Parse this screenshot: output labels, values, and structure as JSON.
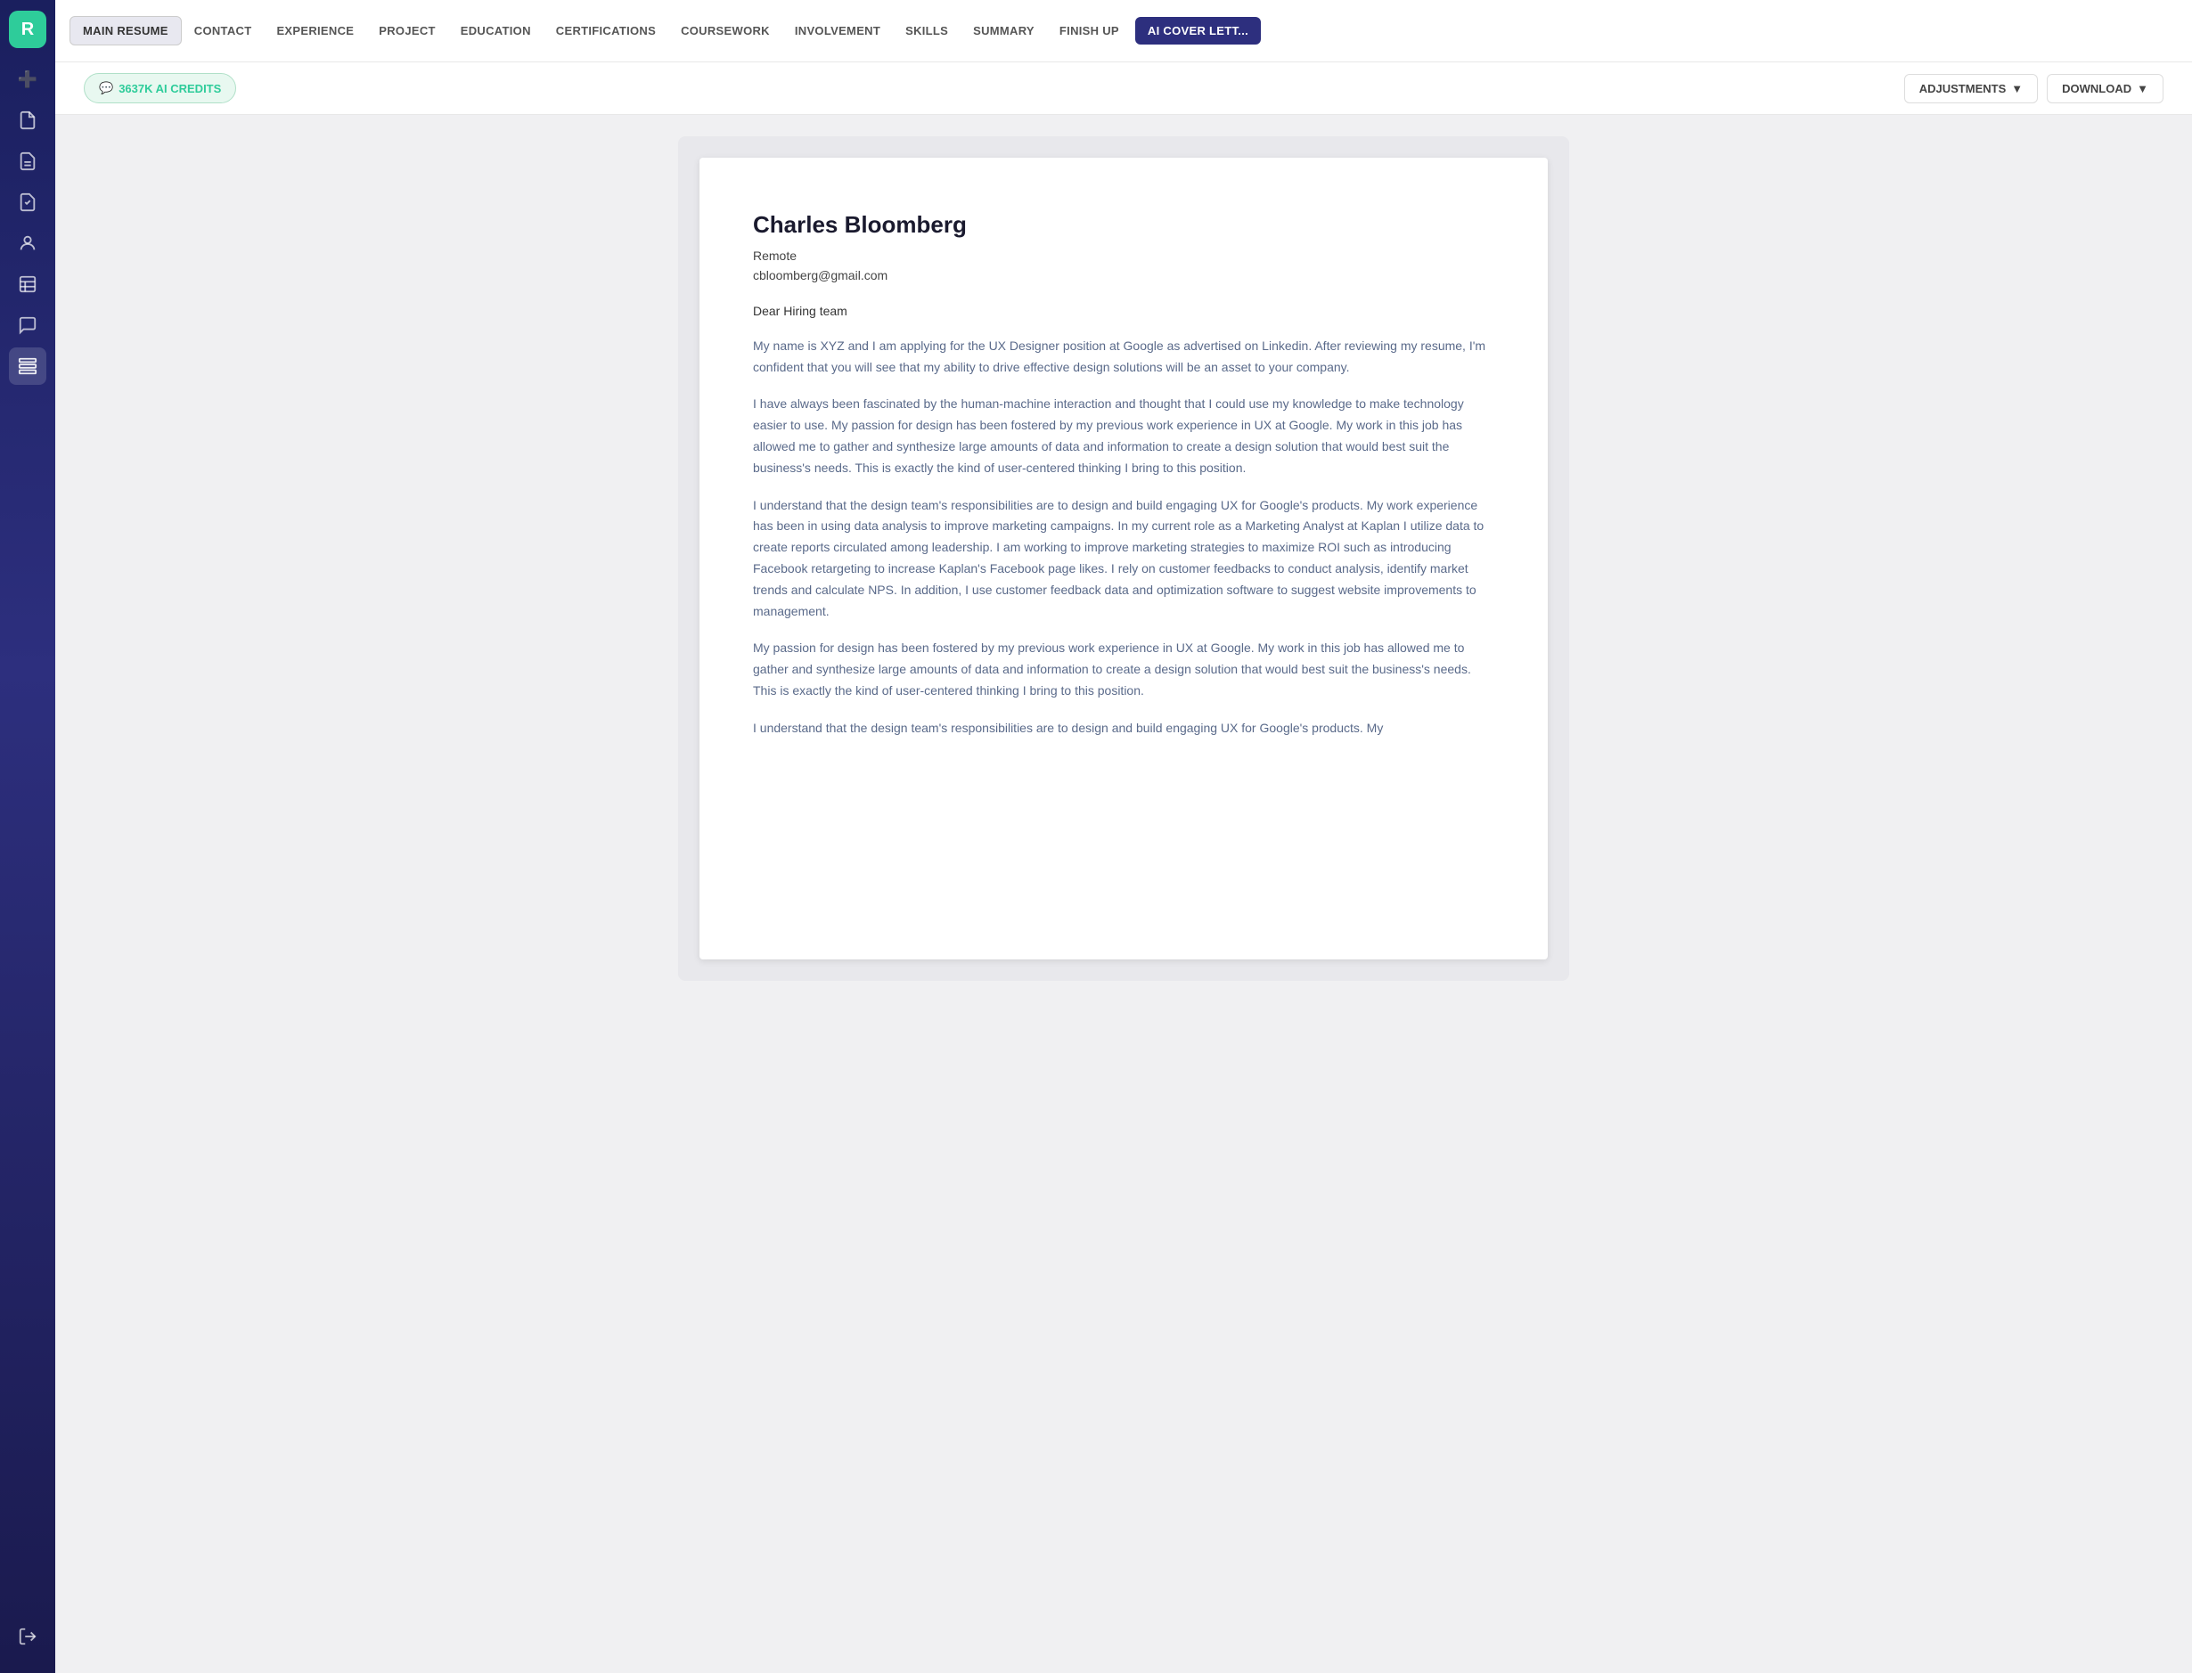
{
  "sidebar": {
    "logo_text": "R",
    "icons": [
      {
        "name": "add-document-icon",
        "symbol": "📄",
        "active": false
      },
      {
        "name": "document-icon",
        "symbol": "📄",
        "active": false
      },
      {
        "name": "document-list-icon",
        "symbol": "📋",
        "active": false
      },
      {
        "name": "document-check-icon",
        "symbol": "✅",
        "active": false
      },
      {
        "name": "profile-icon",
        "symbol": "👤",
        "active": false
      },
      {
        "name": "table-icon",
        "symbol": "📊",
        "active": false
      },
      {
        "name": "chat-icon",
        "symbol": "💬",
        "active": false
      },
      {
        "name": "stack-icon",
        "symbol": "📚",
        "active": true
      }
    ],
    "logout_icon": "➡️"
  },
  "nav": {
    "items": [
      {
        "id": "main-resume",
        "label": "MAIN RESUME",
        "active": true
      },
      {
        "id": "contact",
        "label": "CONTACT",
        "active": false
      },
      {
        "id": "experience",
        "label": "EXPERIENCE",
        "active": false
      },
      {
        "id": "project",
        "label": "PROJECT",
        "active": false
      },
      {
        "id": "education",
        "label": "EDUCATION",
        "active": false
      },
      {
        "id": "certifications",
        "label": "CERTIFICATIONS",
        "active": false
      },
      {
        "id": "coursework",
        "label": "COURSEWORK",
        "active": false
      },
      {
        "id": "involvement",
        "label": "INVOLVEMENT",
        "active": false
      },
      {
        "id": "skills",
        "label": "SKILLS",
        "active": false
      },
      {
        "id": "summary",
        "label": "SUMMARY",
        "active": false
      },
      {
        "id": "finish-up",
        "label": "FINISH UP",
        "active": false
      },
      {
        "id": "ai-cover-letter",
        "label": "AI COVER LETT...",
        "active": false,
        "highlight": true
      }
    ]
  },
  "toolbar": {
    "credits_icon": "💬",
    "credits_label": "3637K AI CREDITS",
    "adjustments_label": "ADJUSTMENTS",
    "adjustments_icon": "▼",
    "download_label": "DOWNLOAD",
    "download_icon": "▼"
  },
  "document": {
    "name": "Charles Bloomberg",
    "location": "Remote",
    "email": "cbloomberg@gmail.com",
    "greeting": "Dear Hiring team",
    "paragraphs": [
      "My name is XYZ and I am applying for the UX Designer position at Google as advertised on Linkedin. After reviewing my resume, I'm confident that you will see that my ability to drive effective design solutions will be an asset to your company.",
      "I have always been fascinated by the human-machine interaction and thought that I could use my knowledge to make technology easier to use. My passion for design has been fostered by my previous work experience in UX at Google. My work in this job has allowed me to gather and synthesize large amounts of data and information to create a design solution that would best suit the business's needs. This is exactly the kind of user-centered thinking I bring to this position.",
      "I understand that the design team's responsibilities are to design and build engaging UX for Google's products. My work experience has been in using data analysis to improve marketing campaigns. In my current role as a Marketing Analyst at Kaplan I utilize data to create reports circulated among leadership. I am working to improve marketing strategies to maximize ROI such as introducing Facebook retargeting to increase Kaplan's Facebook page likes. I rely on customer feedbacks to conduct analysis, identify market trends and calculate NPS. In addition, I use customer feedback data and optimization software to suggest website improvements to management.",
      "My passion for design has been fostered by my previous work experience in UX at Google. My work in this job has allowed me to gather and synthesize large amounts of data and information to create a design solution that would best suit the business's needs. This is exactly the kind of user-centered thinking I bring to this position.",
      "I understand that the design team's responsibilities are to design and build engaging UX for Google's products. My"
    ]
  }
}
